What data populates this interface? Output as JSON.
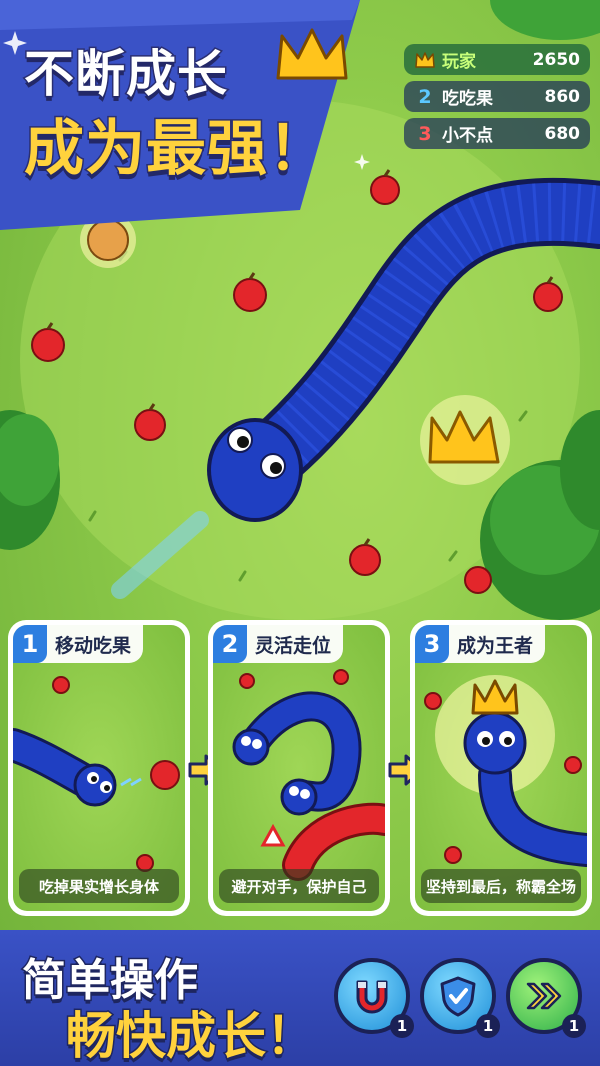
{
  "title": {
    "line1": "不断成长",
    "line2": "成为最强！"
  },
  "leaderboard": [
    {
      "rank": "",
      "icon": "crown-icon",
      "name": "玩家",
      "score": "2650"
    },
    {
      "rank": "2",
      "name": "吃吃果",
      "score": "860"
    },
    {
      "rank": "3",
      "name": "小不点",
      "score": "680"
    }
  ],
  "cards": [
    {
      "num": "1",
      "title": "移动吃果",
      "caption": "吃掉果实增长身体"
    },
    {
      "num": "2",
      "title": "灵活走位",
      "caption": "避开对手，保护自己"
    },
    {
      "num": "3",
      "title": "成为王者",
      "caption": "坚持到最后，称霸全场"
    }
  ],
  "slogan": {
    "line1": "简单操作",
    "line2": "畅快成长！"
  },
  "powerups": [
    {
      "icon": "magnet-icon",
      "count": "1"
    },
    {
      "icon": "shield-icon",
      "count": "1"
    },
    {
      "icon": "speed-boost-icon",
      "count": "1"
    }
  ],
  "colors": {
    "snake": "#1f3fc2",
    "banner": "#3a52c6",
    "title_yellow": "#ffd23d",
    "apple": "#e3262b"
  }
}
